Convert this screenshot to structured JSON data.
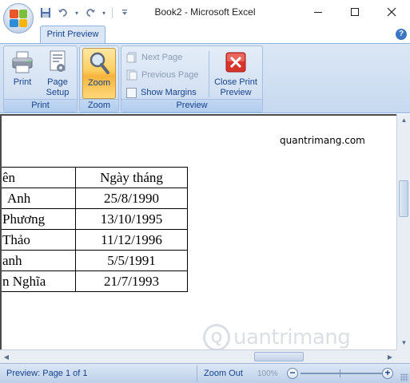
{
  "window": {
    "title": "Book2 - Microsoft Excel",
    "controls": {
      "minimize": "—",
      "maximize": "☐",
      "close": "✕"
    }
  },
  "quick_access": {
    "items": [
      {
        "icon": "save-icon",
        "glyph": "💾"
      },
      {
        "icon": "undo-icon",
        "glyph": "↶"
      },
      {
        "icon": "redo-icon",
        "glyph": "↷"
      },
      {
        "icon": "customize-icon",
        "glyph": "⌄"
      }
    ]
  },
  "ribbon": {
    "active_tab": "Print Preview",
    "help_glyph": "?",
    "groups": {
      "print": {
        "label": "Print",
        "buttons": {
          "print": "Print",
          "page_setup_line1": "Page",
          "page_setup_line2": "Setup"
        }
      },
      "zoom": {
        "label": "Zoom",
        "buttons": {
          "zoom": "Zoom"
        }
      },
      "preview": {
        "label": "Preview",
        "next_page": "Next Page",
        "previous_page": "Previous Page",
        "show_margins": "Show Margins",
        "show_margins_checked": false,
        "close_line1": "Close Print",
        "close_line2": "Preview"
      }
    }
  },
  "preview": {
    "header_text": "quantrimang.com",
    "table": {
      "header": [
        "ên",
        "Ngày tháng"
      ],
      "rows": [
        [
          "Anh",
          "25/8/1990"
        ],
        [
          "Phương",
          "13/10/1995"
        ],
        [
          "Thảo",
          "11/12/1996"
        ],
        [
          "anh",
          "5/5/1991"
        ],
        [
          "n Nghĩa",
          "21/7/1993"
        ]
      ]
    },
    "watermark": "uantrimang"
  },
  "status_bar": {
    "page_info": "Preview: Page 1 of 1",
    "zoom_out": "Zoom Out",
    "zoom_level": "100%",
    "zoom_minus": "−",
    "zoom_plus": "+"
  },
  "colors": {
    "ribbon_text": "#15428b",
    "ribbon_bg": "#dbe7f5",
    "active_button": "#fbce5e",
    "close_icon_red": "#d9342b"
  }
}
